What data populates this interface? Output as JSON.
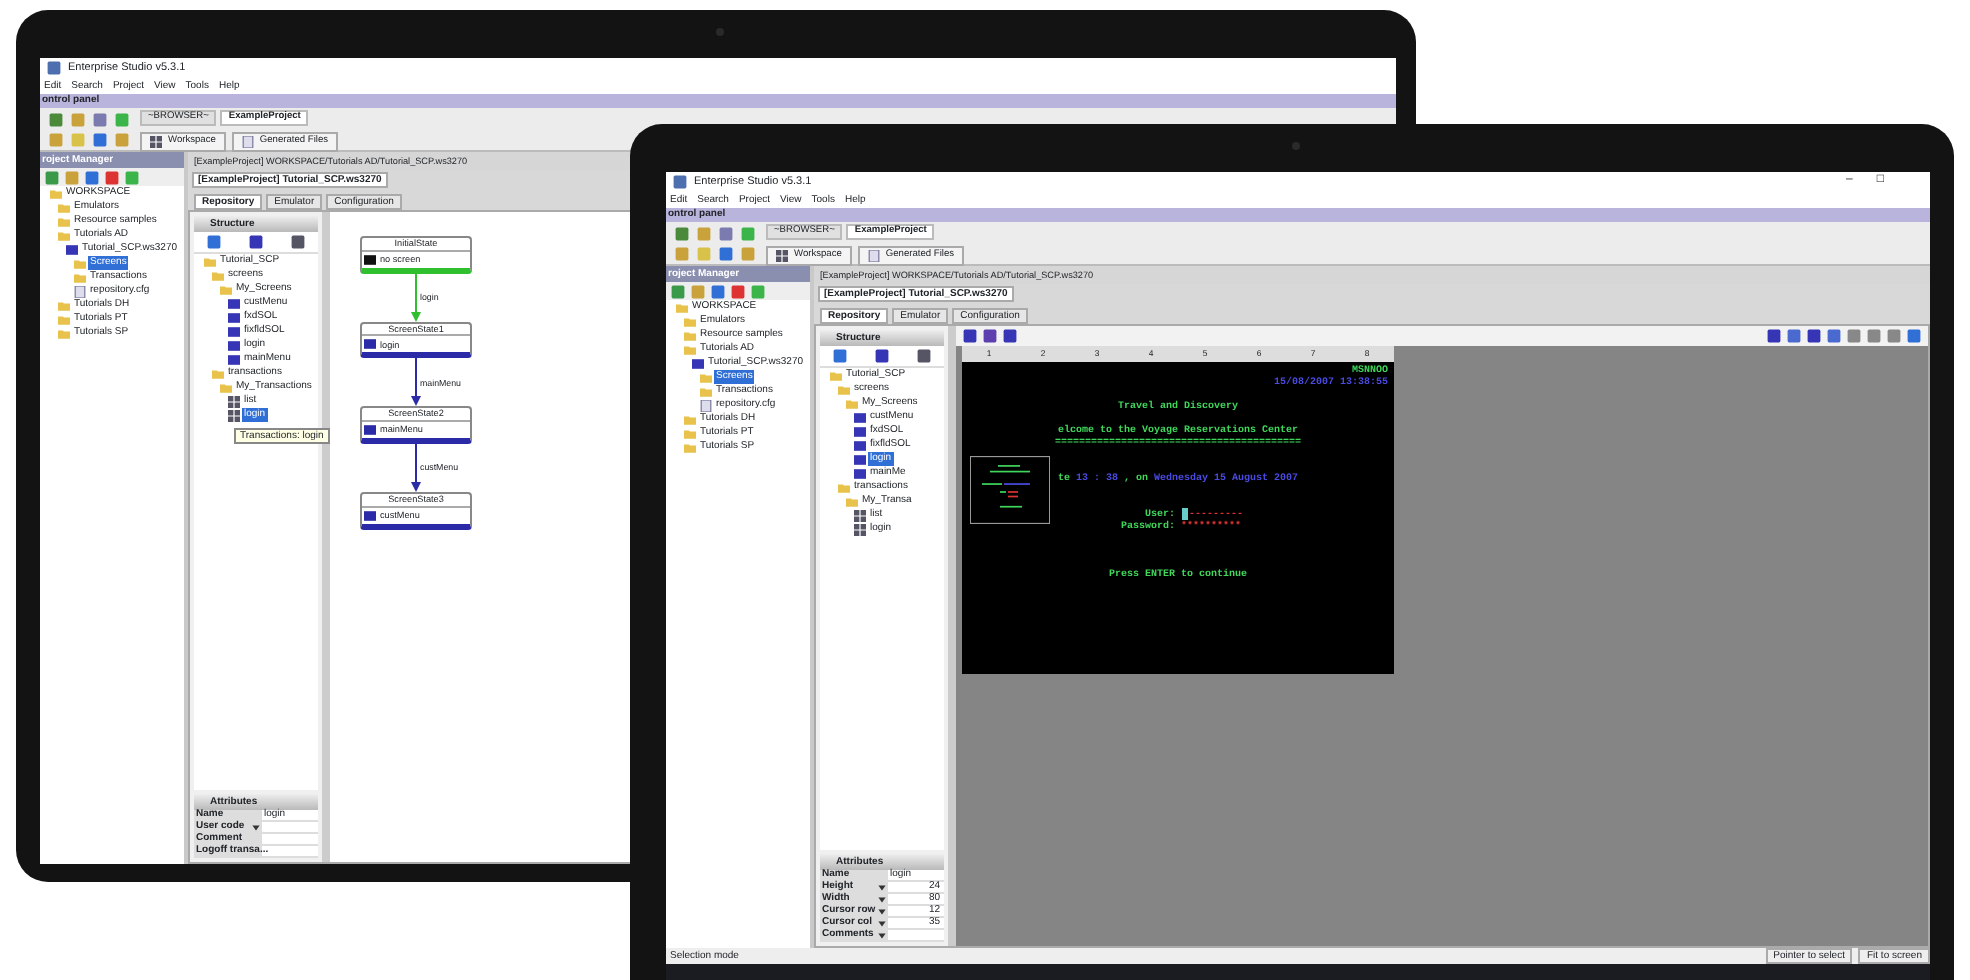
{
  "back_screen": {
    "window": {
      "title": "Enterprise Studio v5.3.1"
    },
    "menu": [
      "Edit",
      "Search",
      "Project",
      "View",
      "Tools",
      "Help"
    ],
    "control_panel": "ontrol panel",
    "project_tabs": [
      {
        "label": "~BROWSER~",
        "selected": false
      },
      {
        "label": "ExampleProject",
        "selected": true
      }
    ],
    "toolbar_buttons": [
      "Workspace",
      "Generated Files"
    ],
    "project_manager": {
      "title": "roject Manager",
      "tree": [
        {
          "label": "WORKSPACE",
          "kind": "folder",
          "selected": false,
          "children": [
            {
              "label": "Emulators",
              "kind": "folder",
              "selected": false
            },
            {
              "label": "Resource samples",
              "kind": "folder",
              "selected": false
            },
            {
              "label": "Tutorials AD",
              "kind": "folder",
              "selected": false,
              "children": [
                {
                  "label": "Tutorial_SCP.ws3270",
                  "kind": "screen",
                  "selected": false,
                  "children": [
                    {
                      "label": "Screens",
                      "kind": "folder",
                      "selected": true
                    },
                    {
                      "label": "Transactions",
                      "kind": "folder",
                      "selected": false
                    },
                    {
                      "label": "repository.cfg",
                      "kind": "file",
                      "selected": false
                    }
                  ]
                }
              ]
            },
            {
              "label": "Tutorials DH",
              "kind": "folder",
              "selected": false
            },
            {
              "label": "Tutorials PT",
              "kind": "folder",
              "selected": false
            },
            {
              "label": "Tutorials SP",
              "kind": "folder",
              "selected": false
            }
          ]
        }
      ]
    },
    "breadcrumb": "[ExampleProject] WORKSPACE/Tutorials AD/Tutorial_SCP.ws3270",
    "editor_tab": "[ExampleProject] Tutorial_SCP.ws3270",
    "editor_tabs": [
      {
        "label": "Repository",
        "selected": true
      },
      {
        "label": "Emulator",
        "selected": false
      },
      {
        "label": "Configuration",
        "selected": false
      }
    ],
    "structure": {
      "title": "Structure",
      "tree": [
        {
          "label": "Tutorial_SCP",
          "kind": "folder",
          "selected": false,
          "children": [
            {
              "label": "screens",
              "kind": "folder",
              "selected": false,
              "children": [
                {
                  "label": "My_Screens",
                  "kind": "folder",
                  "selected": false,
                  "children": [
                    {
                      "label": "custMenu",
                      "kind": "screen",
                      "selected": false
                    },
                    {
                      "label": "fxdSOL",
                      "kind": "screen",
                      "selected": false
                    },
                    {
                      "label": "fixfldSOL",
                      "kind": "screen",
                      "selected": false
                    },
                    {
                      "label": "login",
                      "kind": "screen",
                      "selected": false
                    },
                    {
                      "label": "mainMenu",
                      "kind": "screen",
                      "selected": false
                    }
                  ]
                }
              ]
            },
            {
              "label": "transactions",
              "kind": "folder",
              "selected": false,
              "children": [
                {
                  "label": "My_Transactions",
                  "kind": "folder",
                  "selected": false,
                  "children": [
                    {
                      "label": "list",
                      "kind": "grid",
                      "selected": false
                    },
                    {
                      "label": "login",
                      "kind": "grid",
                      "selected": true
                    }
                  ]
                }
              ]
            }
          ]
        }
      ]
    },
    "tooltip": "Transactions: login",
    "attributes": {
      "title": "Attributes",
      "rows": [
        {
          "name": "Name",
          "value": "login",
          "kind": "text"
        },
        {
          "name": "User code",
          "kind": "dropdown"
        },
        {
          "name": "Comment",
          "kind": "text"
        },
        {
          "name": "Logoff transa...",
          "kind": "text"
        }
      ]
    },
    "diagram": {
      "nodes": [
        {
          "title": "InitialState",
          "screen": "no screen",
          "color": "#2fbf2f"
        },
        {
          "title": "ScreenState1",
          "screen": "login",
          "color": "#2b2ba8"
        },
        {
          "title": "ScreenState2",
          "screen": "mainMenu",
          "color": "#2b2ba8"
        },
        {
          "title": "ScreenState3",
          "screen": "custMenu",
          "color": "#2b2ba8"
        }
      ],
      "edges": [
        {
          "label": "login",
          "color": "#2fbf2f"
        },
        {
          "label": "mainMenu",
          "color": "#2b2ba8"
        },
        {
          "label": "custMenu",
          "color": "#2b2ba8"
        }
      ]
    }
  },
  "front_screen": {
    "window": {
      "title": "Enterprise Studio v5.3.1",
      "controls": [
        "–",
        "□"
      ]
    },
    "menu": [
      "Edit",
      "Search",
      "Project",
      "View",
      "Tools",
      "Help"
    ],
    "control_panel": "ontrol panel",
    "project_tabs": [
      {
        "label": "~BROWSER~",
        "selected": false
      },
      {
        "label": "ExampleProject",
        "selected": true
      }
    ],
    "toolbar_buttons": [
      "Workspace",
      "Generated Files"
    ],
    "project_manager": {
      "title": "roject Manager",
      "tree": [
        {
          "label": "WORKSPACE",
          "kind": "folder",
          "selected": false,
          "children": [
            {
              "label": "Emulators",
              "kind": "folder",
              "selected": false
            },
            {
              "label": "Resource samples",
              "kind": "folder",
              "selected": false
            },
            {
              "label": "Tutorials AD",
              "kind": "folder",
              "selected": false,
              "children": [
                {
                  "label": "Tutorial_SCP.ws3270",
                  "kind": "screen",
                  "selected": false,
                  "children": [
                    {
                      "label": "Screens",
                      "kind": "folder",
                      "selected": true
                    },
                    {
                      "label": "Transactions",
                      "kind": "folder",
                      "selected": false
                    },
                    {
                      "label": "repository.cfg",
                      "kind": "file",
                      "selected": false
                    }
                  ]
                }
              ]
            },
            {
              "label": "Tutorials DH",
              "kind": "folder",
              "selected": false
            },
            {
              "label": "Tutorials PT",
              "kind": "folder",
              "selected": false
            },
            {
              "label": "Tutorials SP",
              "kind": "folder",
              "selected": false
            }
          ]
        }
      ]
    },
    "breadcrumb": "[ExampleProject] WORKSPACE/Tutorials AD/Tutorial_SCP.ws3270",
    "editor_tab": "[ExampleProject] Tutorial_SCP.ws3270",
    "editor_tabs": [
      {
        "label": "Repository",
        "selected": true
      },
      {
        "label": "Emulator",
        "selected": false
      },
      {
        "label": "Configuration",
        "selected": false
      }
    ],
    "structure": {
      "title": "Structure",
      "tree": [
        {
          "label": "Tutorial_SCP",
          "kind": "folder",
          "selected": false,
          "children": [
            {
              "label": "screens",
              "kind": "folder",
              "selected": false,
              "children": [
                {
                  "label": "My_Screens",
                  "kind": "folder",
                  "selected": false,
                  "children": [
                    {
                      "label": "custMenu",
                      "kind": "screen",
                      "selected": false
                    },
                    {
                      "label": "fxdSOL",
                      "kind": "screen",
                      "selected": false
                    },
                    {
                      "label": "fixfldSOL",
                      "kind": "screen",
                      "selected": false
                    },
                    {
                      "label": "login",
                      "kind": "screen",
                      "selected": true
                    },
                    {
                      "label": "mainMe",
                      "kind": "screen",
                      "selected": false
                    }
                  ]
                }
              ]
            },
            {
              "label": "transactions",
              "kind": "folder",
              "selected": false,
              "children": [
                {
                  "label": "My_Transa",
                  "kind": "folder",
                  "selected": false,
                  "children": [
                    {
                      "label": "list",
                      "kind": "grid",
                      "selected": false
                    },
                    {
                      "label": "login",
                      "kind": "grid",
                      "selected": false
                    }
                  ]
                }
              ]
            }
          ]
        }
      ]
    },
    "attributes": {
      "title": "Attributes",
      "rows": [
        {
          "name": "Name",
          "value": "login",
          "kind": "text"
        },
        {
          "name": "Height",
          "value": "24",
          "kind": "dropdown"
        },
        {
          "name": "Width",
          "value": "80",
          "kind": "dropdown"
        },
        {
          "name": "Cursor row",
          "value": "12",
          "kind": "dropdown"
        },
        {
          "name": "Cursor col",
          "value": "35",
          "kind": "dropdown"
        },
        {
          "name": "Comments",
          "kind": "dropdown"
        }
      ]
    },
    "ruler": [
      "1",
      "2",
      "3",
      "4",
      "5",
      "6",
      "7",
      "8"
    ],
    "emulator": {
      "lines": [
        {
          "kind": "corner",
          "segments": [
            {
              "text": "MSNNOO",
              "color": "#3fd65a"
            }
          ]
        },
        {
          "kind": "corner",
          "segments": [
            {
              "text": "15/08/2007 13:38:55",
              "color": "#4a4ae0"
            }
          ]
        },
        {
          "kind": "blank"
        },
        {
          "kind": "text",
          "segments": [
            {
              "text": "Travel and Discovery",
              "color": "#3fd65a"
            }
          ]
        },
        {
          "kind": "blank"
        },
        {
          "kind": "text",
          "segments": [
            {
              "text": "elcome to the Voyage Reservations Center",
              "color": "#3fd65a"
            }
          ]
        },
        {
          "kind": "text",
          "segments": [
            {
              "text": "=========================================",
              "color": "#3fd65a"
            }
          ]
        },
        {
          "kind": "blank"
        },
        {
          "kind": "blank"
        },
        {
          "kind": "text",
          "segments": [
            {
              "text": "te ",
              "color": "#3fd65a"
            },
            {
              "text": "13 : 38",
              "color": "#4a4ae0"
            },
            {
              "text": " , on ",
              "color": "#3fd65a"
            },
            {
              "text": "Wednesday 15 August 2007",
              "color": "#4a4ae0"
            }
          ]
        },
        {
          "kind": "blank"
        },
        {
          "kind": "blank"
        },
        {
          "kind": "field",
          "label": "User:",
          "value": "---------",
          "cursor": true
        },
        {
          "kind": "field",
          "label": "Password:",
          "value": "**********",
          "cursor": false
        },
        {
          "kind": "blank"
        },
        {
          "kind": "blank"
        },
        {
          "kind": "blank"
        },
        {
          "kind": "text",
          "segments": [
            {
              "text": "Press ENTER to continue",
              "color": "#3fd65a"
            }
          ]
        }
      ]
    },
    "status_bar": {
      "left": "Selection mode",
      "right": [
        "Pointer to select",
        "Fit to screen"
      ]
    }
  }
}
